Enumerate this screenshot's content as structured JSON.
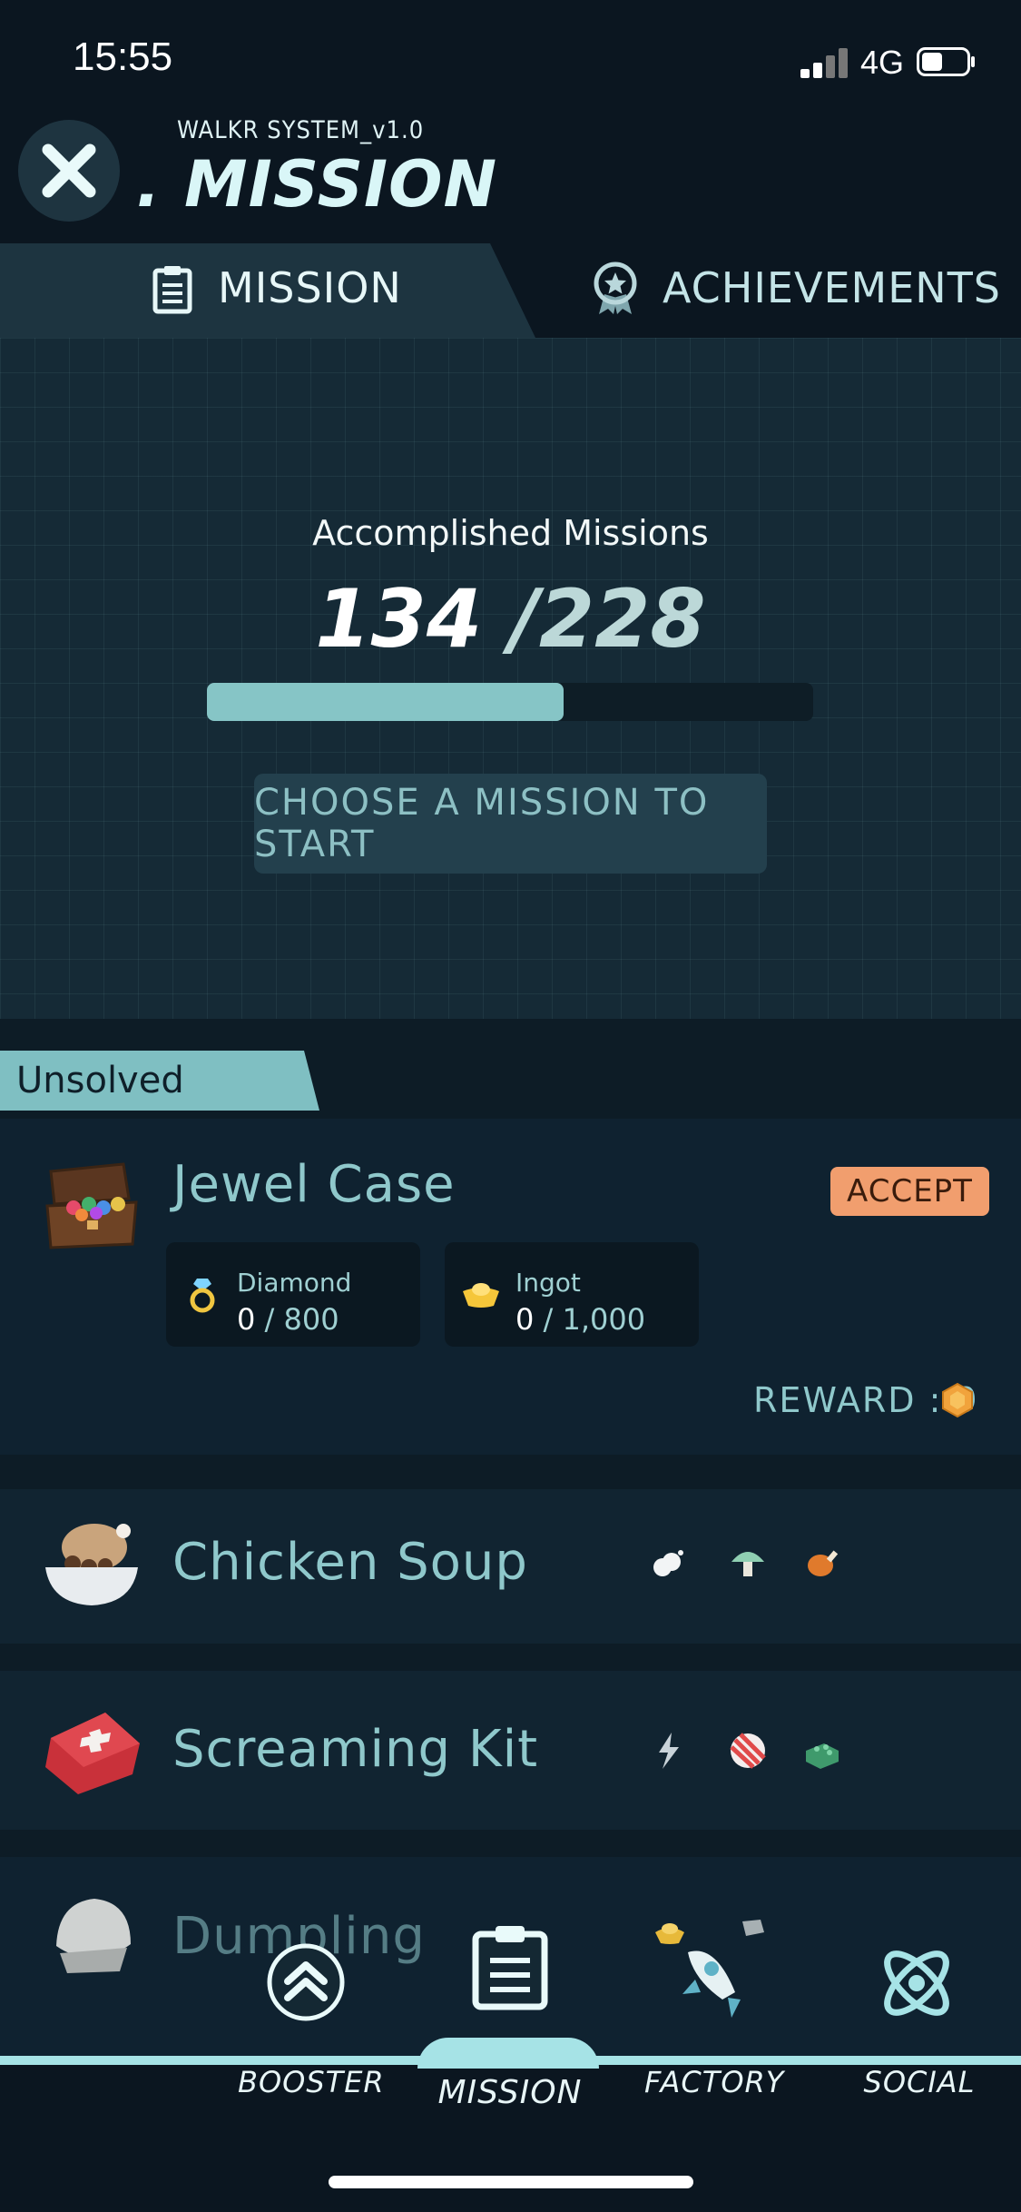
{
  "status_bar": {
    "time": "15:55",
    "network": "4G"
  },
  "header": {
    "system_label": "WALKR SYSTEM_v1.0",
    "title": ". MISSION"
  },
  "tabs": [
    {
      "label": "MISSION",
      "icon": "clipboard-icon",
      "active": true
    },
    {
      "label": "ACHIEVEMENTS",
      "icon": "medal-icon",
      "active": false
    }
  ],
  "summary": {
    "label": "Accomplished Missions",
    "done": "134",
    "total": "/228",
    "progress_fraction": 0.588,
    "choose_button": "CHOOSE A MISSION TO START"
  },
  "section_label": "Unsolved",
  "missions": [
    {
      "name": "Jewel Case",
      "icon": "jewel-case-icon",
      "accept_label": "ACCEPT",
      "requirements": [
        {
          "name": "Diamond",
          "have": "0",
          "need": " / 800",
          "icon": "diamond-ring-icon"
        },
        {
          "name": "Ingot",
          "have": "0",
          "need": " / 1,000",
          "icon": "gold-ingot-icon"
        }
      ],
      "reward_label": "REWARD : 9",
      "reward_icon": "hex-coin-icon"
    },
    {
      "name": "Chicken Soup",
      "icon": "chicken-soup-icon",
      "resources": [
        "cloud-icon",
        "mushroom-icon",
        "drumstick-icon"
      ]
    },
    {
      "name": "Screaming Kit",
      "icon": "first-aid-kit-icon",
      "resources": [
        "lightning-icon",
        "striped-ball-icon",
        "brick-icon"
      ]
    },
    {
      "name": "Dumpling",
      "icon": "dumpling-icon"
    }
  ],
  "nav": [
    {
      "label": "BOOSTER",
      "icon": "chevrons-up-icon"
    },
    {
      "label": "MISSION",
      "icon": "clipboard-icon",
      "active": true
    },
    {
      "label": "FACTORY",
      "icon": "rocket-icon"
    },
    {
      "label": "SOCIAL",
      "icon": "atom-icon"
    }
  ],
  "colors": {
    "accent": "#86c5c6",
    "accept": "#f19e6e",
    "background": "#0c1a24"
  }
}
